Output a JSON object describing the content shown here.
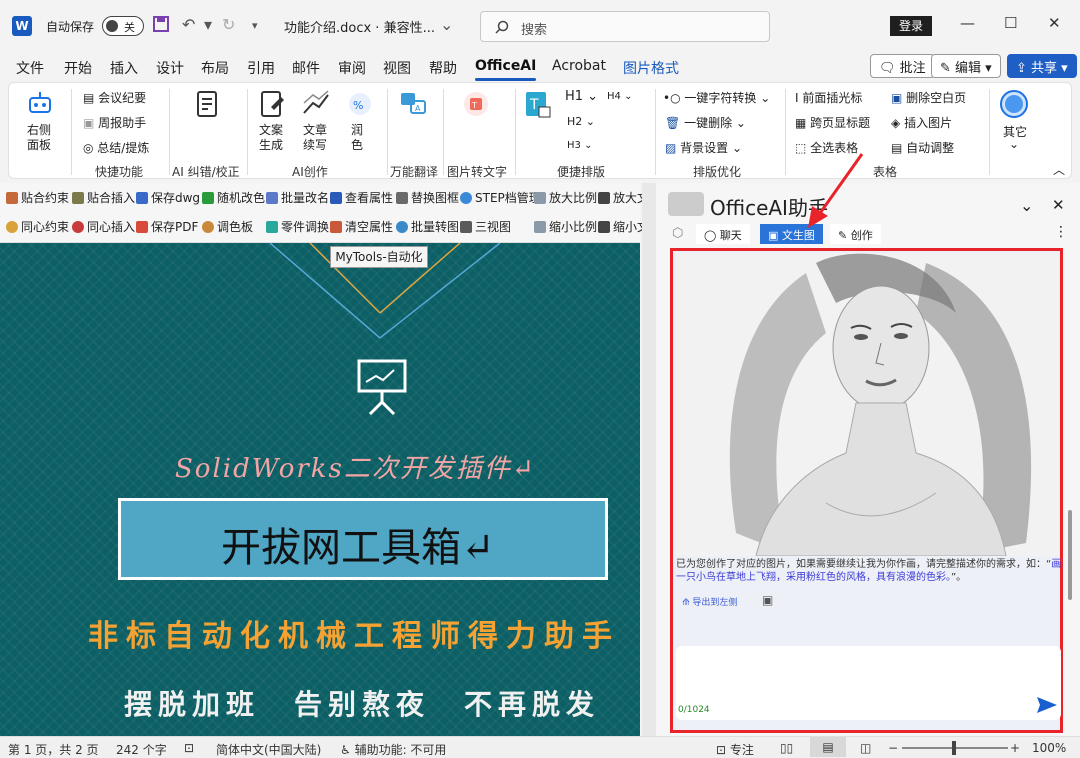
{
  "titlebar": {
    "app_icon": "W",
    "autosave_label": "自动保存",
    "autosave_state": "关",
    "doc_name": "功能介绍.docx · 兼容性...",
    "search_placeholder": "搜索",
    "login_label": "登录"
  },
  "tabs": [
    "文件",
    "开始",
    "插入",
    "设计",
    "布局",
    "引用",
    "邮件",
    "审阅",
    "视图",
    "帮助",
    "OfficeAI",
    "Acrobat",
    "图片格式"
  ],
  "active_tab": "OfficeAI",
  "right_buttons": {
    "comments": "批注",
    "edit": "编辑",
    "share": "共享"
  },
  "ribbon": {
    "btn_panel": "右侧\n面板",
    "meeting": "会议纪要",
    "weekly": "周报助手",
    "summary": "总结/提炼",
    "group_quick": "快捷功能",
    "group_ai_check": "AI 纠错/校正",
    "gen": "文案\n生成",
    "cont": "文章\n续写",
    "polish": "润\n色",
    "group_ai_create": "AI创作",
    "group_translate": "万能翻译",
    "group_img2text": "图片转文字",
    "h1": "H1",
    "h2": "H2",
    "h3": "H3",
    "h4": "H4",
    "group_layout": "便捷排版",
    "one_key_conv": "一键字符转换",
    "one_key_del": "一键删除",
    "bg_setting": "背景设置",
    "group_opt": "排版优化",
    "insert_cursor": "前面插光标",
    "cross_header": "跨页显标题",
    "select_table": "全选表格",
    "del_blank": "删除空白页",
    "insert_img": "插入图片",
    "auto_adjust": "自动调整",
    "group_table": "表格",
    "other": "其它"
  },
  "mytools": {
    "row1": [
      "贴合约束",
      "贴合插入",
      "保存dwg",
      "随机改色",
      "批量改名",
      "查看属性",
      "替换图框",
      "STEP档管理",
      "放大比例",
      "放大文"
    ],
    "row2": [
      "同心约束",
      "同心插入",
      "保存PDF",
      "调色板",
      "零件调换",
      "清空属性",
      "批量转图",
      "三视图",
      "缩小比例",
      "缩小文"
    ],
    "tooltip": "MyTools-自动化"
  },
  "document": {
    "line1": "SolidWorks二次开发插件↵",
    "title": "开拔网工具箱↵",
    "line2": "非标自动化机械工程师得力助手",
    "line3": "摆脱加班　告别熬夜　不再脱发"
  },
  "panel": {
    "title": "OfficeAI助手",
    "tabs": [
      "聊天",
      "文生图",
      "创作"
    ],
    "active_tab": "文生图",
    "message_plain": "已为您创作了对应的图片，如果需要继续让我为你作画，请完整描述你的需求，如：“",
    "message_example": "画一只小鸟在草地上飞翔，采用粉红色的风格，具有浪漫的色彩。",
    "message_end": "”。",
    "export_label": "导出到左侧",
    "char_counter": "0/1024"
  },
  "status": {
    "page": "第 1 页，共 2 页",
    "words": "242 个字",
    "lang": "简体中文(中国大陆)",
    "accessibility": "辅助功能: 不可用",
    "focus": "专注",
    "zoom": "100%"
  },
  "colors": {
    "accent": "#185abd",
    "share": "#1f5fc5",
    "highlight_border": "#e8232a",
    "doc_bg": "#0c5f64"
  }
}
